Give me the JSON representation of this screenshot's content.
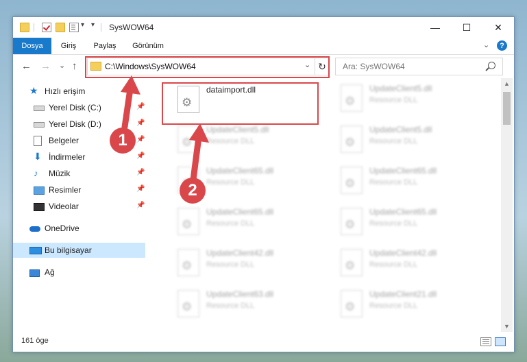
{
  "window": {
    "title": "SysWOW64",
    "controls": {
      "minimize": "—",
      "maximize": "☐",
      "close": "✕"
    }
  },
  "ribbon": {
    "tabs": [
      "Dosya",
      "Giriş",
      "Paylaş",
      "Görünüm"
    ],
    "active_tab": "Dosya",
    "help": "?"
  },
  "navigation": {
    "back": "←",
    "forward": "→",
    "recent": "⌄",
    "up": "↑",
    "address": "C:\\Windows\\SysWOW64",
    "address_dropdown": "⌄",
    "refresh": "↻",
    "search_placeholder": "Ara: SysWOW64"
  },
  "sidebar": {
    "items": [
      {
        "label": "Hızlı erişim",
        "icon": "star-icon"
      },
      {
        "label": "Yerel Disk (C:)",
        "icon": "drive-icon",
        "pinned": true
      },
      {
        "label": "Yerel Disk (D:)",
        "icon": "drive-icon",
        "pinned": true
      },
      {
        "label": "Belgeler",
        "icon": "document-icon",
        "pinned": true
      },
      {
        "label": "İndirmeler",
        "icon": "download-icon",
        "pinned": true
      },
      {
        "label": "Müzik",
        "icon": "music-icon",
        "pinned": true
      },
      {
        "label": "Resimler",
        "icon": "pictures-icon",
        "pinned": true
      },
      {
        "label": "Videolar",
        "icon": "videos-icon",
        "pinned": true
      },
      {
        "label": "OneDrive",
        "icon": "cloud-icon"
      },
      {
        "label": "Bu bilgisayar",
        "icon": "computer-icon",
        "selected": true
      },
      {
        "label": "Ağ",
        "icon": "network-icon"
      }
    ],
    "pin_glyph": "📌"
  },
  "files": {
    "highlighted": {
      "name": "dataimport.dll"
    },
    "left_column": [
      {
        "name": "UpdateClient5.dll",
        "type": "Resource DLL"
      },
      {
        "name": "UpdateClient65.dll",
        "type": "Resource DLL"
      },
      {
        "name": "UpdateClient65.dll",
        "type": "Resource DLL"
      },
      {
        "name": "UpdateClient42.dll",
        "type": "Resource DLL"
      },
      {
        "name": "UpdateClient63.dll",
        "type": "Resource DLL"
      }
    ],
    "right_column": [
      {
        "name": "UpdateClient5.dll",
        "type": "Resource DLL"
      },
      {
        "name": "UpdateClient5.dll",
        "type": "Resource DLL"
      },
      {
        "name": "UpdateClient65.dll",
        "type": "Resource DLL"
      },
      {
        "name": "UpdateClient65.dll",
        "type": "Resource DLL"
      },
      {
        "name": "UpdateClient42.dll",
        "type": "Resource DLL"
      },
      {
        "name": "UpdateClient21.dll",
        "type": "Resource DLL"
      }
    ]
  },
  "status": {
    "item_count": "161 öge"
  },
  "annotations": {
    "step1": "1",
    "step2": "2",
    "color": "#d9474b"
  }
}
